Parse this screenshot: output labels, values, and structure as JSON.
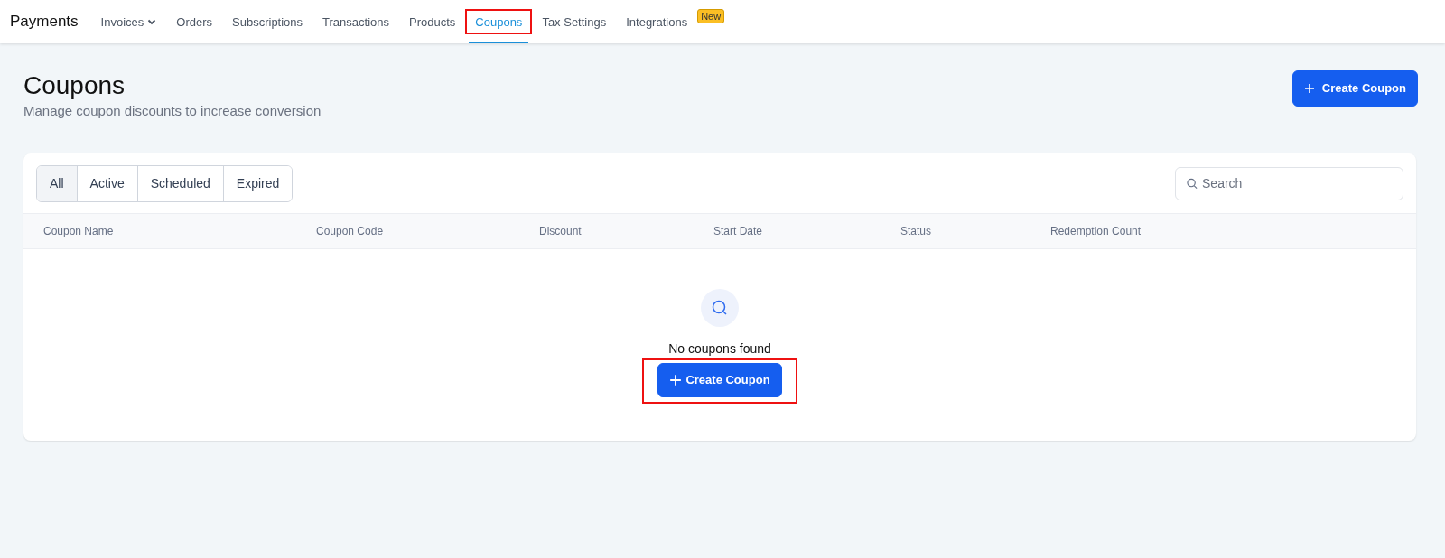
{
  "app_title": "Payments",
  "nav": [
    {
      "label": "Invoices",
      "has_dropdown": true,
      "selected": false,
      "highlighted": false
    },
    {
      "label": "Orders",
      "has_dropdown": false,
      "selected": false,
      "highlighted": false
    },
    {
      "label": "Subscriptions",
      "has_dropdown": false,
      "selected": false,
      "highlighted": false
    },
    {
      "label": "Transactions",
      "has_dropdown": false,
      "selected": false,
      "highlighted": false
    },
    {
      "label": "Products",
      "has_dropdown": false,
      "selected": false,
      "highlighted": false
    },
    {
      "label": "Coupons",
      "has_dropdown": false,
      "selected": true,
      "highlighted": true
    },
    {
      "label": "Tax Settings",
      "has_dropdown": false,
      "selected": false,
      "highlighted": false
    },
    {
      "label": "Integrations",
      "has_dropdown": false,
      "selected": false,
      "highlighted": false,
      "badge": "New"
    }
  ],
  "page": {
    "title": "Coupons",
    "subtitle": "Manage coupon discounts to increase conversion",
    "create_button": "Create Coupon"
  },
  "filters": [
    {
      "label": "All",
      "selected": true
    },
    {
      "label": "Active",
      "selected": false
    },
    {
      "label": "Scheduled",
      "selected": false
    },
    {
      "label": "Expired",
      "selected": false
    }
  ],
  "search": {
    "placeholder": "Search"
  },
  "table": {
    "columns": [
      "Coupon Name",
      "Coupon Code",
      "Discount",
      "Start Date",
      "Status",
      "Redemption Count"
    ]
  },
  "empty_state": {
    "message": "No coupons found",
    "button": "Create Coupon",
    "highlighted": true
  }
}
